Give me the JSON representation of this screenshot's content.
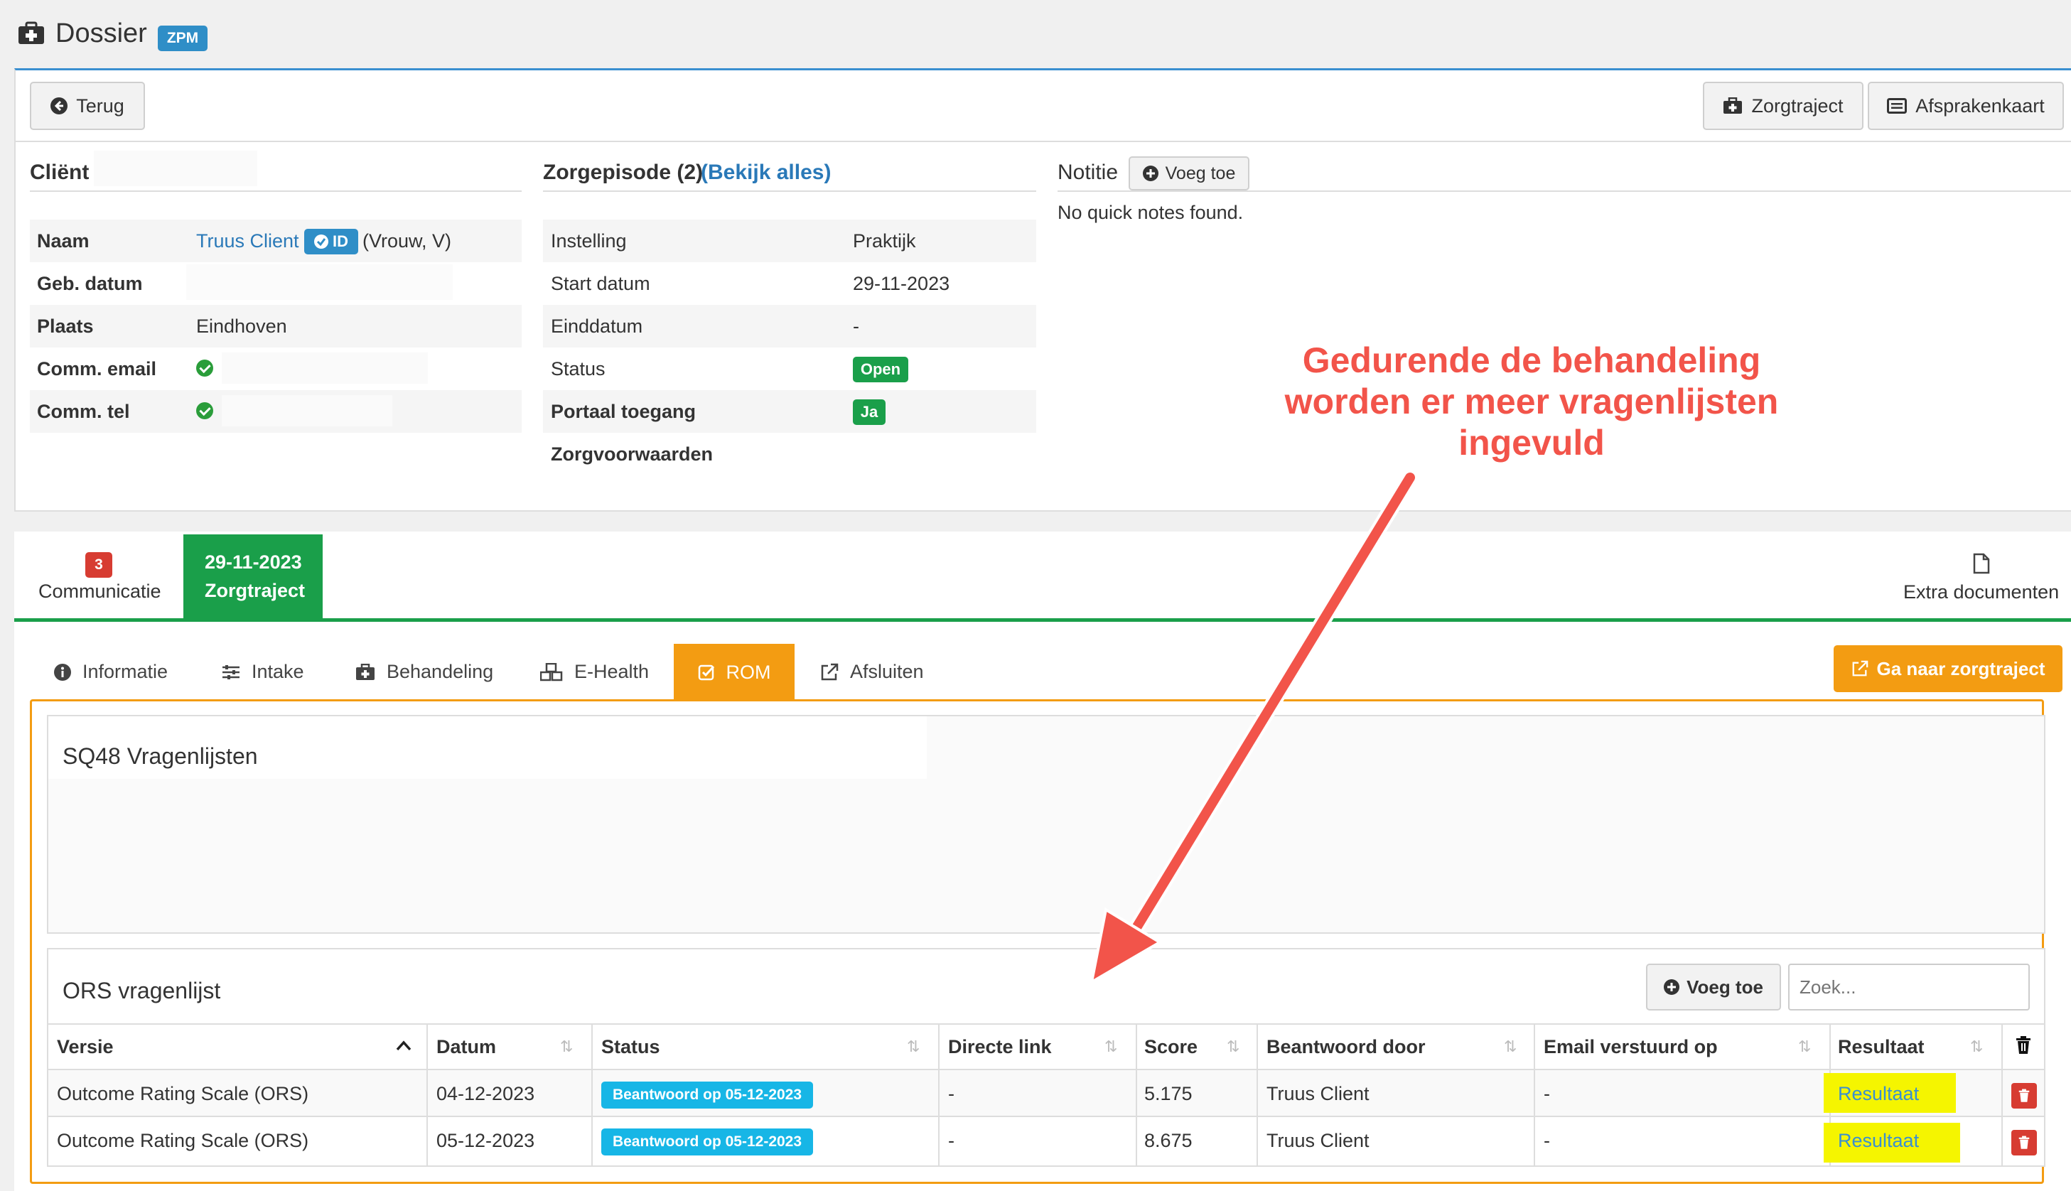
{
  "header": {
    "title": "Dossier",
    "badge": "ZPM"
  },
  "toolbar": {
    "back": "Terug",
    "zorgtraject": "Zorgtraject",
    "afsprakenkaart": "Afsprakenkaart"
  },
  "client": {
    "heading": "Cliënt",
    "rows": [
      {
        "label": "Naam",
        "value": "Truus Client",
        "id_badge": "ID",
        "extra": "(Vrouw, V)"
      },
      {
        "label": "Geb. datum",
        "value": ""
      },
      {
        "label": "Plaats",
        "value": "Eindhoven"
      },
      {
        "label": "Comm. email",
        "value": ""
      },
      {
        "label": "Comm. tel",
        "value": ""
      }
    ]
  },
  "episode": {
    "heading": "Zorgepisode (2)",
    "link": "(Bekijk alles)",
    "rows": [
      {
        "label": "Instelling",
        "value": "Praktijk"
      },
      {
        "label": "Start datum",
        "value": "29-11-2023"
      },
      {
        "label": "Einddatum",
        "value": "-"
      },
      {
        "label": "Status",
        "value": "Open"
      },
      {
        "label": "Portaal toegang",
        "value": "Ja"
      },
      {
        "label": "Zorgvoorwaarden",
        "value": ""
      }
    ]
  },
  "notes": {
    "heading": "Notitie",
    "add": "Voeg toe",
    "empty": "No quick notes found."
  },
  "annotation": {
    "line1": "Gedurende de behandeling",
    "line2": "worden er meer vragenlijsten",
    "line3": "ingevuld"
  },
  "main_tabs": {
    "communicatie": {
      "count": "3",
      "label": "Communicatie"
    },
    "zorgtraject": {
      "date": "29-11-2023",
      "label": "Zorgtraject"
    },
    "extra": "Extra documenten"
  },
  "sub_tabs": [
    "Informatie",
    "Intake",
    "Behandeling",
    "E-Health",
    "ROM",
    "Afsluiten"
  ],
  "goto_button": "Ga naar zorgtraject",
  "sq48": {
    "title": "SQ48 Vragenlijsten"
  },
  "ors": {
    "title": "ORS vragenlijst",
    "add": "Voeg toe",
    "search_placeholder": "Zoek...",
    "columns": [
      "Versie",
      "Datum",
      "Status",
      "Directe link",
      "Score",
      "Beantwoord door",
      "Email verstuurd op",
      "Resultaat"
    ],
    "rows": [
      {
        "versie": "Outcome Rating Scale (ORS)",
        "datum": "04-12-2023",
        "status": "Beantwoord op 05-12-2023",
        "link": "-",
        "score": "5.175",
        "door": "Truus Client",
        "email": "-",
        "resultaat": "Resultaat"
      },
      {
        "versie": "Outcome Rating Scale (ORS)",
        "datum": "05-12-2023",
        "status": "Beantwoord op 05-12-2023",
        "link": "-",
        "score": "8.675",
        "door": "Truus Client",
        "email": "-",
        "resultaat": "Resultaat"
      }
    ]
  },
  "colors": {
    "accent": "#f39c12",
    "green": "#1a9f4a",
    "link": "#2a79b8",
    "info": "#17b6e6",
    "danger": "#d73c32",
    "highlight": "#f5f500",
    "annotation": "#f2544a"
  }
}
